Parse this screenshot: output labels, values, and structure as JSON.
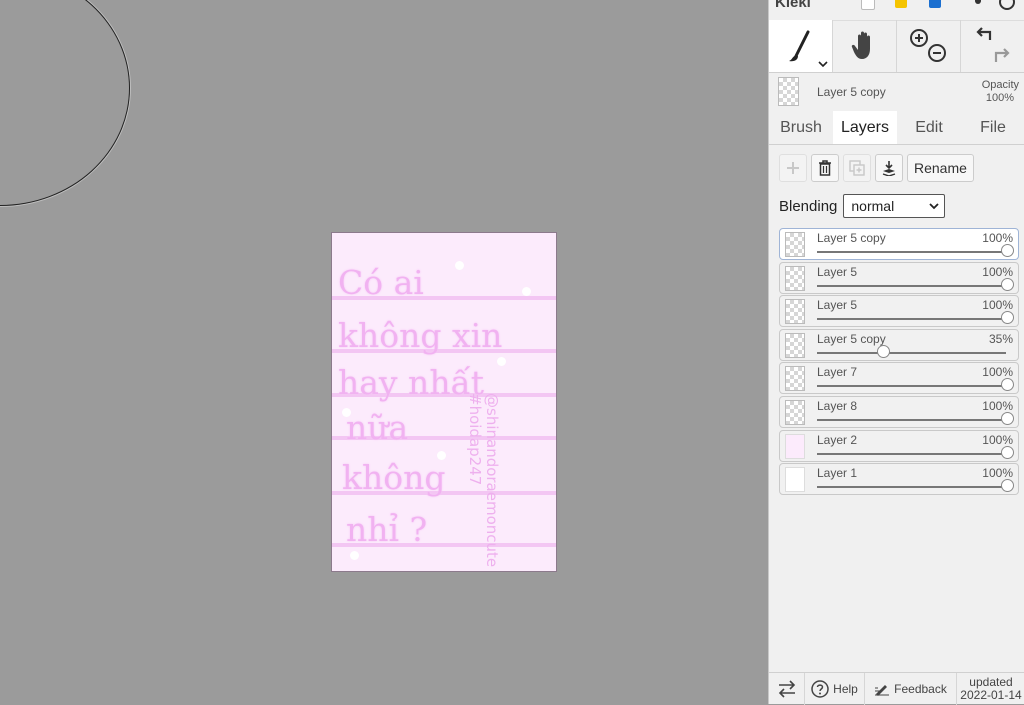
{
  "app": {
    "name": "Kleki"
  },
  "colors": {
    "workspace_bg": "#9b9b9b",
    "canvas_bg": "#fcebfc",
    "canvas_text": "#f1b2f1",
    "panel_bg": "#f0f0f0",
    "selected_border": "#9fb4d6"
  },
  "toolbar": {
    "tools": [
      {
        "name": "brush-tool",
        "icon": "brush-icon",
        "active": true
      },
      {
        "name": "hand-tool",
        "icon": "hand-icon"
      },
      {
        "name": "zoom-tool",
        "icon": "zoom-in-out-icon"
      },
      {
        "name": "undo-redo",
        "icon": "undo-redo-icon"
      }
    ]
  },
  "current_layer": {
    "name": "Layer 5 copy",
    "opacity_label": "Opacity",
    "opacity_value": "100%"
  },
  "tabs": [
    {
      "label": "Brush",
      "active": false
    },
    {
      "label": "Layers",
      "active": true
    },
    {
      "label": "Edit",
      "active": false
    },
    {
      "label": "File",
      "active": false
    }
  ],
  "layer_actions": {
    "rename_label": "Rename"
  },
  "blending": {
    "label": "Blending",
    "value": "normal"
  },
  "layers": [
    {
      "name": "Layer 5 copy",
      "opacity": "100%",
      "level": 1.0,
      "selected": true,
      "thumb": "checker"
    },
    {
      "name": "Layer 5",
      "opacity": "100%",
      "level": 1.0,
      "thumb": "checker"
    },
    {
      "name": "Layer 5",
      "opacity": "100%",
      "level": 1.0,
      "thumb": "checker"
    },
    {
      "name": "Layer 5 copy",
      "opacity": "35%",
      "level": 0.35,
      "thumb": "checker"
    },
    {
      "name": "Layer 7",
      "opacity": "100%",
      "level": 1.0,
      "thumb": "checker"
    },
    {
      "name": "Layer 8",
      "opacity": "100%",
      "level": 1.0,
      "thumb": "checker"
    },
    {
      "name": "Layer 2",
      "opacity": "100%",
      "level": 1.0,
      "thumb": "pink"
    },
    {
      "name": "Layer 1",
      "opacity": "100%",
      "level": 1.0,
      "thumb": "white"
    }
  ],
  "canvas_text": {
    "lines": [
      "Có ai",
      "không xin",
      "hay nhất",
      "nữa",
      "không",
      "nhỉ ?"
    ],
    "vertical_1": "@shinandoraemoncute",
    "vertical_2": "#hoidap247"
  },
  "footer": {
    "help_label": "Help",
    "feedback_label": "Feedback",
    "updated_label": "updated",
    "updated_date": "2022-01-14"
  }
}
